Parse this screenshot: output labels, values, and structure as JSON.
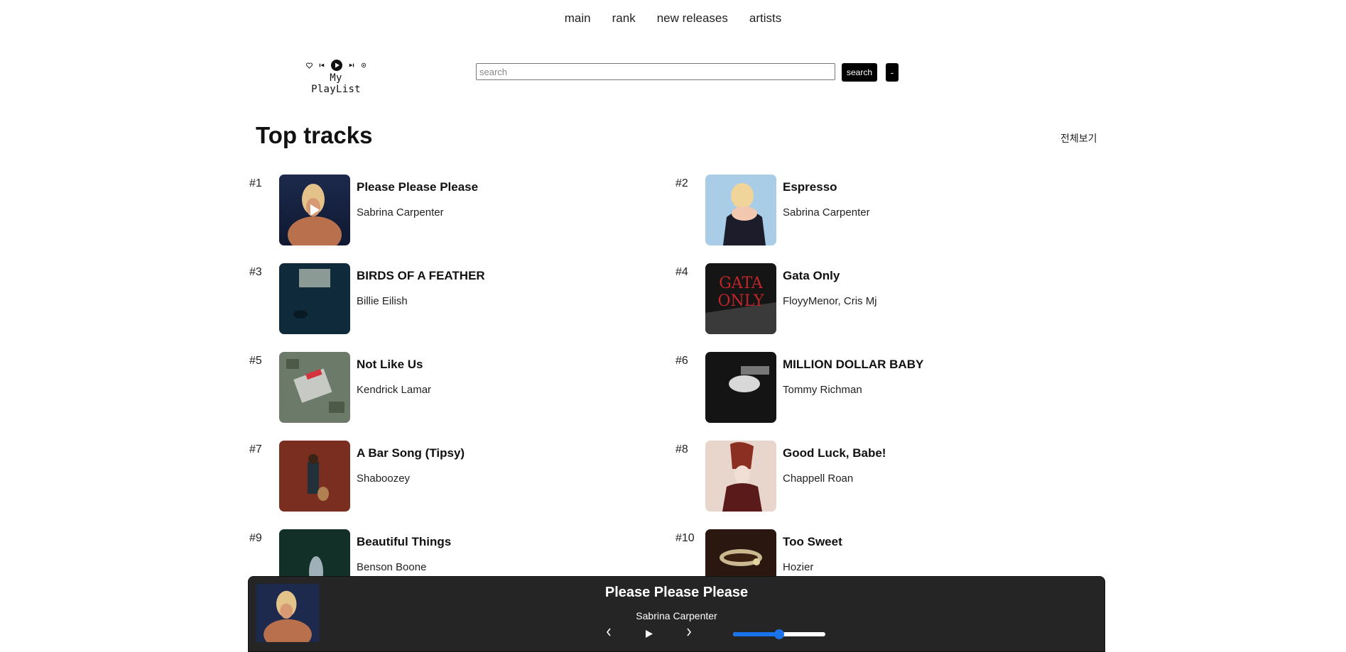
{
  "nav": {
    "items": [
      "main",
      "rank",
      "new releases",
      "artists"
    ]
  },
  "logo": {
    "text": "My PlayList"
  },
  "search": {
    "placeholder": "search",
    "value": "",
    "button_label": "search",
    "minus_label": "-"
  },
  "section": {
    "title": "Top tracks",
    "view_all": "전체보기"
  },
  "tracks": [
    {
      "rank": "#1",
      "title": "Please Please Please",
      "artist": "Sabrina Carpenter"
    },
    {
      "rank": "#2",
      "title": "Espresso",
      "artist": "Sabrina Carpenter"
    },
    {
      "rank": "#3",
      "title": "BIRDS OF A FEATHER",
      "artist": "Billie Eilish"
    },
    {
      "rank": "#4",
      "title": "Gata Only",
      "artist": "FloyyMenor, Cris Mj"
    },
    {
      "rank": "#5",
      "title": "Not Like Us",
      "artist": "Kendrick Lamar"
    },
    {
      "rank": "#6",
      "title": "MILLION DOLLAR BABY",
      "artist": "Tommy Richman"
    },
    {
      "rank": "#7",
      "title": "A Bar Song (Tipsy)",
      "artist": "Shaboozey"
    },
    {
      "rank": "#8",
      "title": "Good Luck, Babe!",
      "artist": "Chappell Roan"
    },
    {
      "rank": "#9",
      "title": "Beautiful Things",
      "artist": "Benson Boone"
    },
    {
      "rank": "#10",
      "title": "Too Sweet",
      "artist": "Hozier"
    }
  ],
  "player": {
    "title": "Please Please Please",
    "artist": "Sabrina Carpenter",
    "prev_icon": "chevron-left-icon",
    "play_icon": "play-icon",
    "next_icon": "chevron-right-icon",
    "volume": 0.5
  },
  "colors": {
    "accent": "#1a73e8",
    "player_bg": "#252525",
    "button_bg": "#000000"
  }
}
